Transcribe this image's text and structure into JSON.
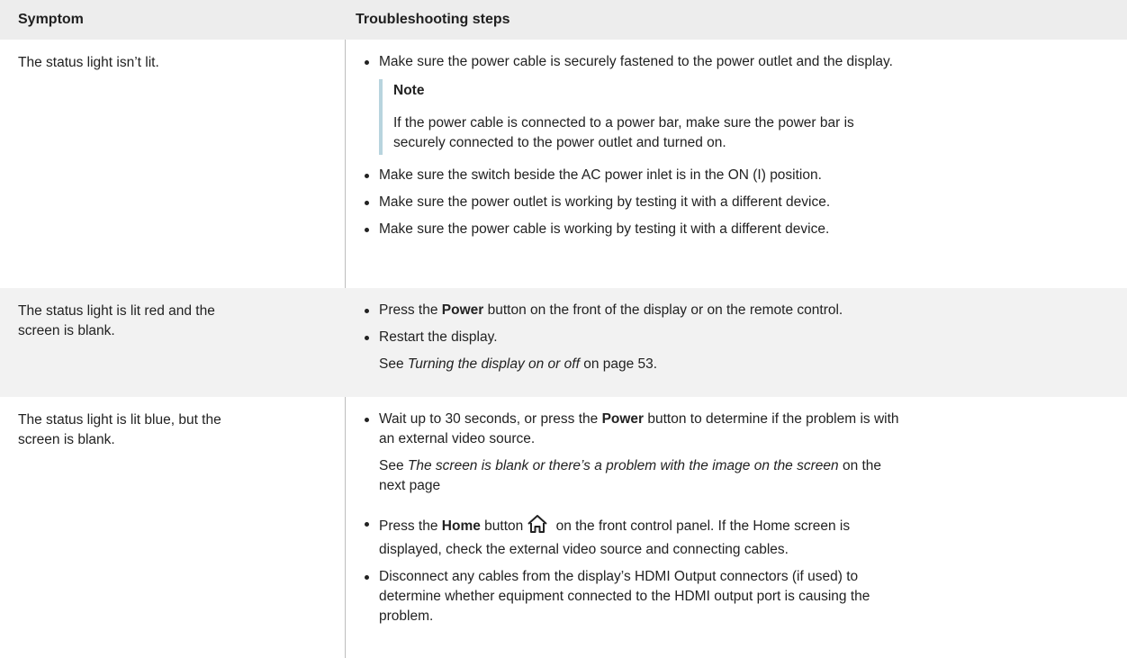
{
  "header": {
    "symptom": "Symptom",
    "steps": "Troubleshooting steps"
  },
  "rows": [
    {
      "symptom": [
        "The status light isn’t lit."
      ],
      "b1": "Make sure the power cable is securely fastened to the power outlet and the display.",
      "note_title": "Note",
      "note_text1": "If the power cable is connected to a power bar, make sure the power bar is",
      "note_text2": "securely connected to the power outlet and turned on.",
      "b2": "Make sure the switch beside the AC power inlet is in the ON (I) position.",
      "b3": "Make sure the power outlet is working by testing it with a different device.",
      "b4": "Make sure the power cable is working by testing it with a different device."
    },
    {
      "symptom": [
        "The status light is lit red and the",
        "screen is blank."
      ],
      "b1_pre": "Press the ",
      "b1_bold": "Power",
      "b1_post": " button on the front of the display or on the remote control.",
      "b2": "Restart the display.",
      "see_pre": "See ",
      "see_link": "Turning the display on or off",
      "see_post": " on page 53."
    },
    {
      "symptom": [
        "The status light is lit blue, but the",
        "screen is blank."
      ],
      "b1_pre": "Wait up to 30 seconds, or press the ",
      "b1_bold": "Power",
      "b1_post": " button to determine if the problem is with",
      "b1_line2": "an external video source.",
      "see_pre": "See ",
      "see_link": "The screen is blank or there’s a problem with the image on the screen",
      "see_post": " on the",
      "see_line2": "next page",
      "b2_pre": "Press the ",
      "b2_bold": "Home",
      "b2_mid": " button",
      "home_icon": "home-icon",
      "b2_post": " on the front control panel. If the Home screen is",
      "b2_line2": "displayed, check the external video source and connecting cables.",
      "b3_line1": "Disconnect any cables from the display’s HDMI Output connectors (if used) to",
      "b3_line2": "determine whether equipment connected to the HDMI output port is causing the",
      "b3_line3": "problem."
    }
  ]
}
